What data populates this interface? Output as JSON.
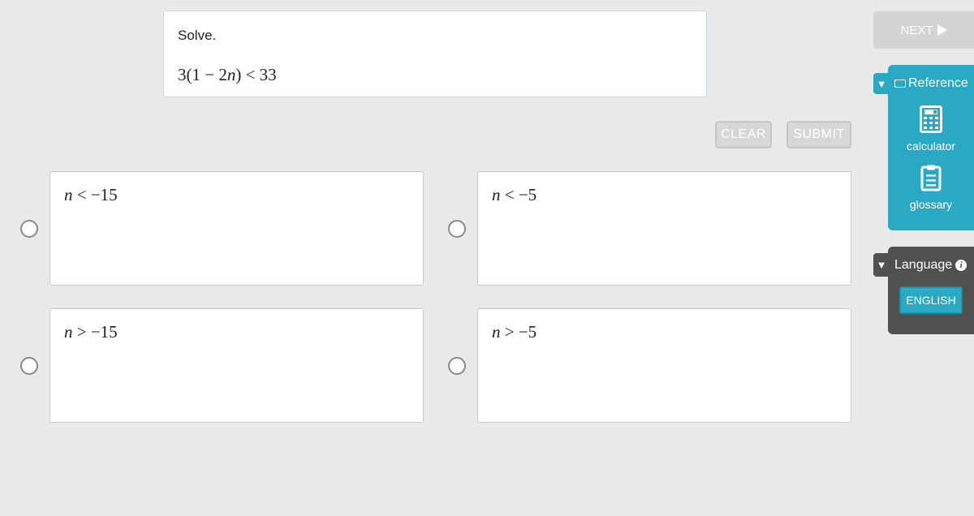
{
  "question": {
    "prompt": "Solve.",
    "expression": {
      "p1": "3(1 − 2",
      "var": "n",
      "p2": ") < 33"
    }
  },
  "buttons": {
    "clear": "CLEAR",
    "submit": "SUBMIT",
    "next": "NEXT"
  },
  "choices": [
    {
      "var": "n",
      "rest": " < −15"
    },
    {
      "var": "n",
      "rest": " < −5"
    },
    {
      "var": "n",
      "rest": " > −15"
    },
    {
      "var": "n",
      "rest": " > −5"
    }
  ],
  "sidebar": {
    "reference": {
      "title": "Reference",
      "tools": [
        {
          "label": "calculator",
          "icon": "calculator-icon"
        },
        {
          "label": "glossary",
          "icon": "clipboard-icon"
        }
      ]
    },
    "language": {
      "title": "Language",
      "current": "ENGLISH"
    }
  },
  "colors": {
    "accent": "#2aa9c4",
    "panel_dark": "#505050",
    "disabled": "#d4d4d4"
  }
}
